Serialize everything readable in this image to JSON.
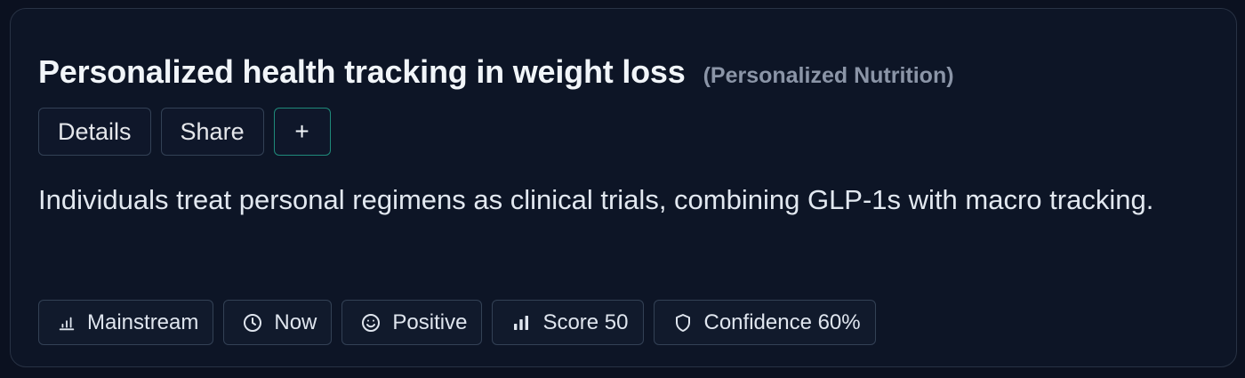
{
  "card": {
    "title": "Personalized health tracking in weight loss",
    "category": "(Personalized Nutrition)",
    "description": "Individuals treat personal regimens as clinical trials, combining GLP-1s with macro tracking.",
    "actions": {
      "details_label": "Details",
      "share_label": "Share",
      "add_label": "+"
    },
    "tags": [
      {
        "icon": "bar-chart-icon",
        "label": "Mainstream"
      },
      {
        "icon": "clock-icon",
        "label": "Now"
      },
      {
        "icon": "smile-icon",
        "label": "Positive"
      },
      {
        "icon": "signal-bars-icon",
        "label": "Score 50"
      },
      {
        "icon": "shield-icon",
        "label": "Confidence 60%"
      }
    ]
  },
  "colors": {
    "background": "#0b1120",
    "card": "#0d1526",
    "border": "#283244",
    "accent": "#1f8a7a",
    "title": "#f1f5f9",
    "muted": "#8b95a7"
  }
}
